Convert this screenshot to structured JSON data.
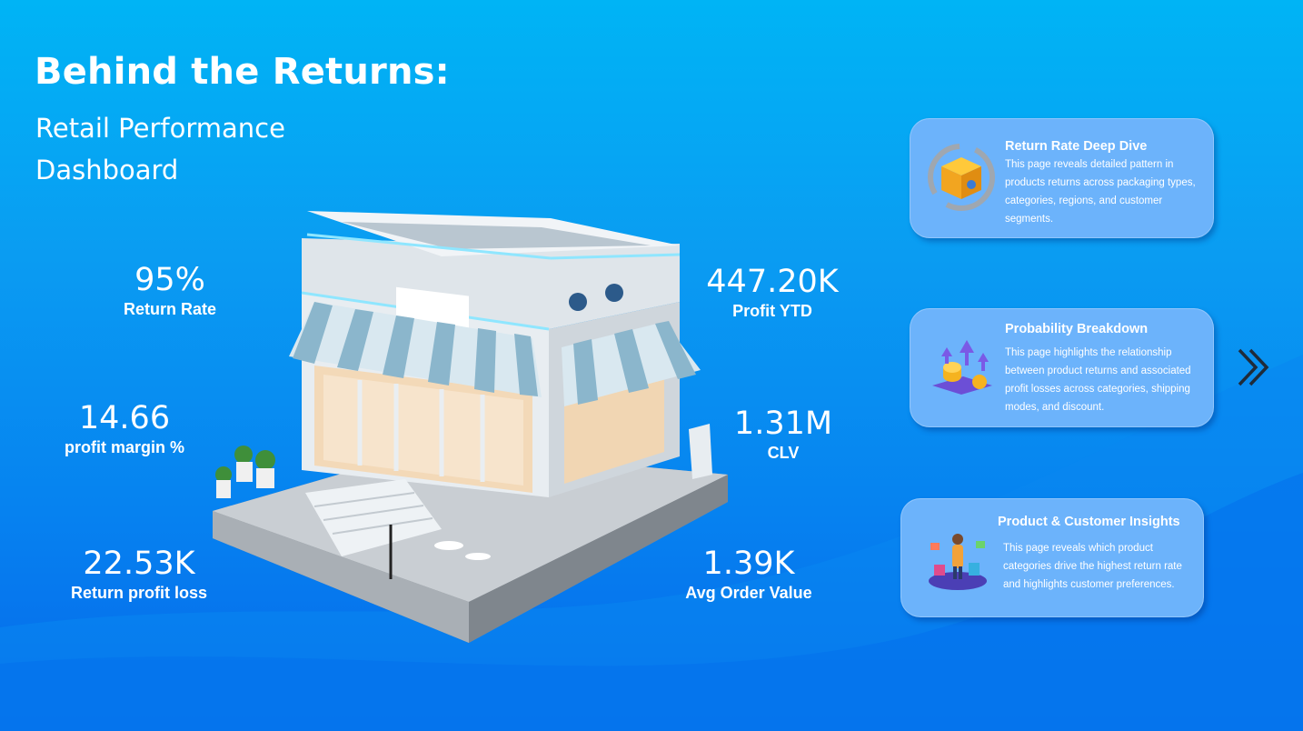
{
  "header": {
    "title": "Behind the Returns:",
    "subtitle": "Retail Performance Dashboard"
  },
  "kpis": [
    {
      "value": "95%",
      "label": "Return Rate"
    },
    {
      "value": "14.66",
      "label": "profit margin %"
    },
    {
      "value": "22.53K",
      "label": "Return profit loss"
    },
    {
      "value": "447.20K",
      "label": "Profit YTD"
    },
    {
      "value": "1.31M",
      "label": "CLV"
    },
    {
      "value": "1.39K",
      "label": "Avg Order Value"
    }
  ],
  "nav_cards": [
    {
      "title": "Return Rate Deep Dive",
      "description": "This page reveals detailed pattern in products returns across packaging types, categories, regions, and customer segments.",
      "icon": "return-box-icon"
    },
    {
      "title": "Probability Breakdown",
      "description": "This page highlights the relationship between product returns and associated profit losses across categories, shipping modes, and discount.",
      "icon": "profit-loss-coins-icon"
    },
    {
      "title": "Product & Customer Insights",
      "description": "This page reveals which product categories drive the highest return rate and highlights customer preferences.",
      "icon": "shopper-icon"
    }
  ],
  "navigation": {
    "next_icon": "double-chevron-right-icon"
  },
  "illustration": {
    "name": "retail-store-illustration"
  },
  "colors": {
    "background_top": "#00b4f5",
    "background_bottom": "#0568ea",
    "card_background": "#6cb3fb",
    "text": "#ffffff"
  }
}
